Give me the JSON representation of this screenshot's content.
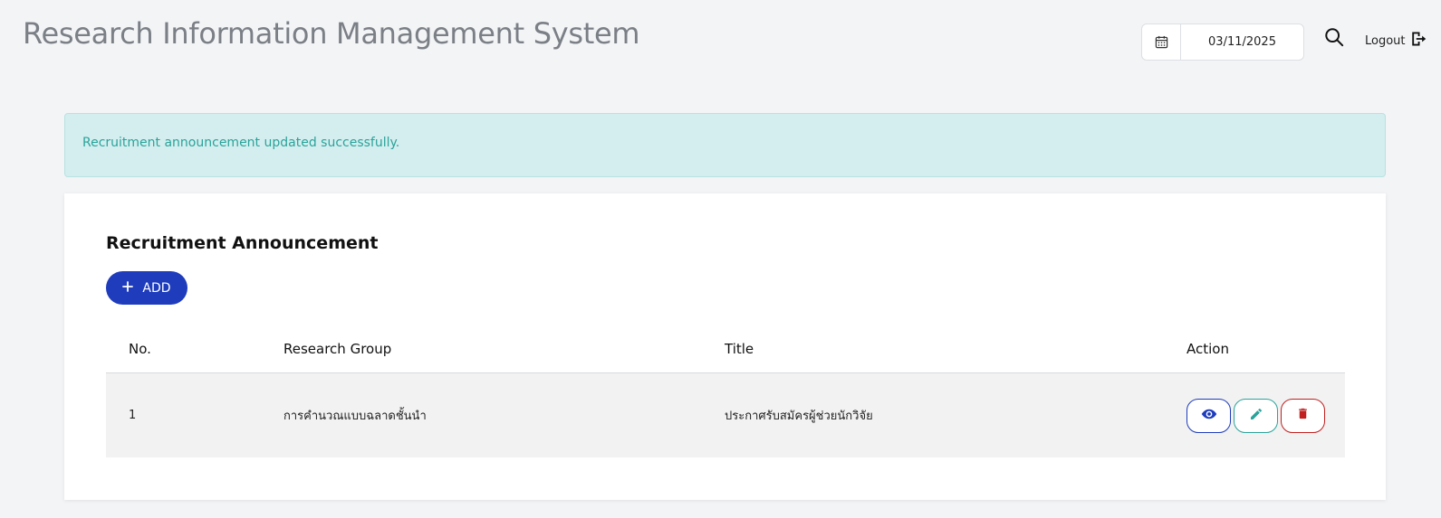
{
  "header": {
    "title": "Research Information Management System",
    "date": "03/11/2025",
    "logout_label": "Logout"
  },
  "icons": {
    "calendar": "calendar-icon",
    "search": "search-icon",
    "logout": "logout-icon",
    "plus": "plus-icon",
    "view": "eye-icon",
    "edit": "pencil-icon",
    "delete": "trash-icon"
  },
  "alert": {
    "message": "Recruitment announcement updated successfully."
  },
  "section": {
    "title": "Recruitment Announcement",
    "add_label": "ADD"
  },
  "table": {
    "headers": {
      "no": "No.",
      "group": "Research Group",
      "title": "Title",
      "action": "Action"
    },
    "rows": [
      {
        "no": "1",
        "group": "การคำนวณแบบฉลาดชั้นนำ",
        "title": "ประกาศรับสมัครผู้ช่วยนักวิจัย"
      }
    ]
  },
  "colors": {
    "primary": "#1e3cbc",
    "success": "#2aa39a",
    "danger": "#c0201f",
    "alert_bg": "#d4eeef"
  }
}
